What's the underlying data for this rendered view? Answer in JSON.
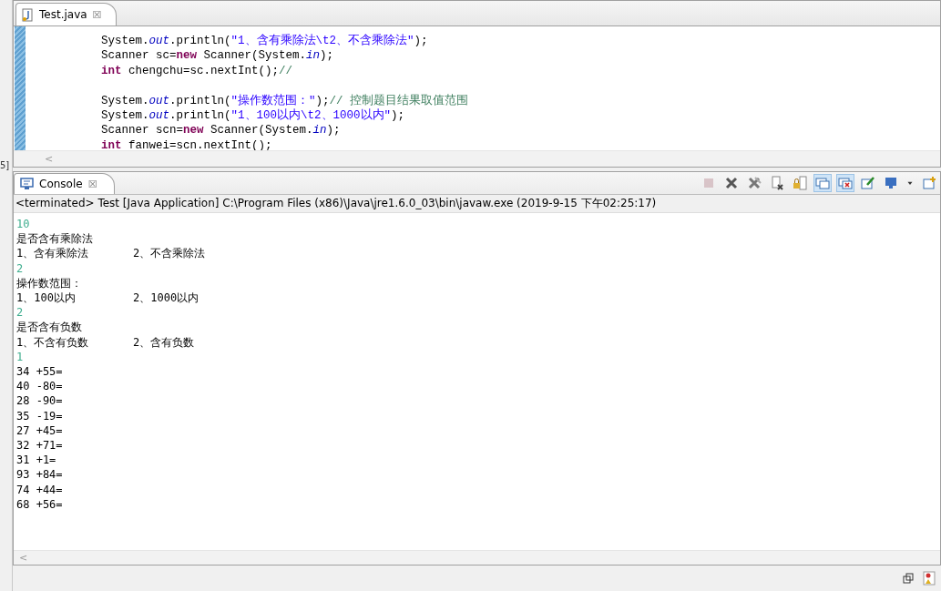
{
  "side_fragment": "5]",
  "editor": {
    "tab": {
      "label": "Test.java",
      "close": "☒"
    },
    "lines": [
      {
        "kind": "code",
        "tokens": [
          {
            "kind": "plain",
            "text": "System."
          },
          {
            "kind": "field",
            "text": "out"
          },
          {
            "kind": "plain",
            "text": ".println("
          },
          {
            "kind": "string",
            "text": "\"1、含有乘除法\\t2、不含乘除法\""
          },
          {
            "kind": "plain",
            "text": ");"
          }
        ]
      },
      {
        "kind": "code",
        "tokens": [
          {
            "kind": "plain",
            "text": "Scanner sc="
          },
          {
            "kind": "keyword",
            "text": "new"
          },
          {
            "kind": "plain",
            "text": " Scanner(System."
          },
          {
            "kind": "field",
            "text": "in"
          },
          {
            "kind": "plain",
            "text": ");"
          }
        ]
      },
      {
        "kind": "code",
        "tokens": [
          {
            "kind": "keyword",
            "text": "int"
          },
          {
            "kind": "plain",
            "text": " chengchu=sc.nextInt();"
          },
          {
            "kind": "comment",
            "text": "//"
          }
        ]
      },
      {
        "kind": "blank"
      },
      {
        "kind": "code",
        "tokens": [
          {
            "kind": "plain",
            "text": "System."
          },
          {
            "kind": "field",
            "text": "out"
          },
          {
            "kind": "plain",
            "text": ".println("
          },
          {
            "kind": "string",
            "text": "\"操作数范围：\""
          },
          {
            "kind": "plain",
            "text": ");"
          },
          {
            "kind": "comment",
            "text": "// 控制题目结果取值范围"
          }
        ]
      },
      {
        "kind": "code",
        "tokens": [
          {
            "kind": "plain",
            "text": "System."
          },
          {
            "kind": "field",
            "text": "out"
          },
          {
            "kind": "plain",
            "text": ".println("
          },
          {
            "kind": "string",
            "text": "\"1、100以内\\t2、1000以内\""
          },
          {
            "kind": "plain",
            "text": ");"
          }
        ]
      },
      {
        "kind": "code",
        "tokens": [
          {
            "kind": "plain",
            "text": "Scanner scn="
          },
          {
            "kind": "keyword",
            "text": "new"
          },
          {
            "kind": "plain",
            "text": " Scanner(System."
          },
          {
            "kind": "field",
            "text": "in"
          },
          {
            "kind": "plain",
            "text": ");"
          }
        ]
      },
      {
        "kind": "code",
        "tokens": [
          {
            "kind": "keyword",
            "text": "int"
          },
          {
            "kind": "plain",
            "text": " fanwei=scn.nextInt();"
          }
        ]
      }
    ],
    "scroll_left": "<"
  },
  "console": {
    "tab": {
      "label": "Console",
      "close": "☒"
    },
    "toolbar": [
      {
        "kind": "terminate",
        "disabled": true,
        "selected": false
      },
      {
        "kind": "remove",
        "disabled": false,
        "selected": false
      },
      {
        "kind": "remove-all",
        "disabled": false,
        "selected": false
      },
      {
        "kind": "clear",
        "disabled": false,
        "selected": false
      },
      {
        "kind": "lock",
        "disabled": false,
        "selected": false
      },
      {
        "kind": "show-out",
        "disabled": false,
        "selected": true
      },
      {
        "kind": "show-err",
        "disabled": false,
        "selected": true
      },
      {
        "kind": "pin",
        "disabled": false,
        "selected": false
      },
      {
        "kind": "display",
        "disabled": false,
        "selected": false
      },
      {
        "kind": "dropdown",
        "disabled": false,
        "selected": false
      },
      {
        "kind": "new",
        "disabled": false,
        "selected": false
      }
    ],
    "info": "<terminated> Test [Java Application] C:\\Program Files (x86)\\Java\\jre1.6.0_03\\bin\\javaw.exe (2019-9-15 下午02:25:17)",
    "output": [
      {
        "kind": "input",
        "parts": [
          "10"
        ]
      },
      {
        "kind": "output",
        "parts": [
          "是否含有乘除法"
        ]
      },
      {
        "kind": "output",
        "parts": [
          "1、含有乘除法",
          "2、不含乘除法"
        ]
      },
      {
        "kind": "input",
        "parts": [
          "2"
        ]
      },
      {
        "kind": "output",
        "parts": [
          "操作数范围："
        ]
      },
      {
        "kind": "output",
        "parts": [
          "1、100以内",
          "2、1000以内"
        ]
      },
      {
        "kind": "input",
        "parts": [
          "2"
        ]
      },
      {
        "kind": "output",
        "parts": [
          "是否含有负数"
        ]
      },
      {
        "kind": "output",
        "parts": [
          "1、不含有负数",
          "2、含有负数"
        ]
      },
      {
        "kind": "input",
        "parts": [
          "1"
        ]
      },
      {
        "kind": "output",
        "parts": [
          "34 +55="
        ]
      },
      {
        "kind": "output",
        "parts": [
          "40 -80="
        ]
      },
      {
        "kind": "output",
        "parts": [
          "28 -90="
        ]
      },
      {
        "kind": "output",
        "parts": [
          "35 -19="
        ]
      },
      {
        "kind": "output",
        "parts": [
          "27 +45="
        ]
      },
      {
        "kind": "output",
        "parts": [
          "32 +71="
        ]
      },
      {
        "kind": "output",
        "parts": [
          "31 +1="
        ]
      },
      {
        "kind": "output",
        "parts": [
          "93 +84="
        ]
      },
      {
        "kind": "output",
        "parts": [
          "74 +44="
        ]
      },
      {
        "kind": "output",
        "parts": [
          "68 +56="
        ]
      }
    ],
    "scroll_left": "<"
  }
}
